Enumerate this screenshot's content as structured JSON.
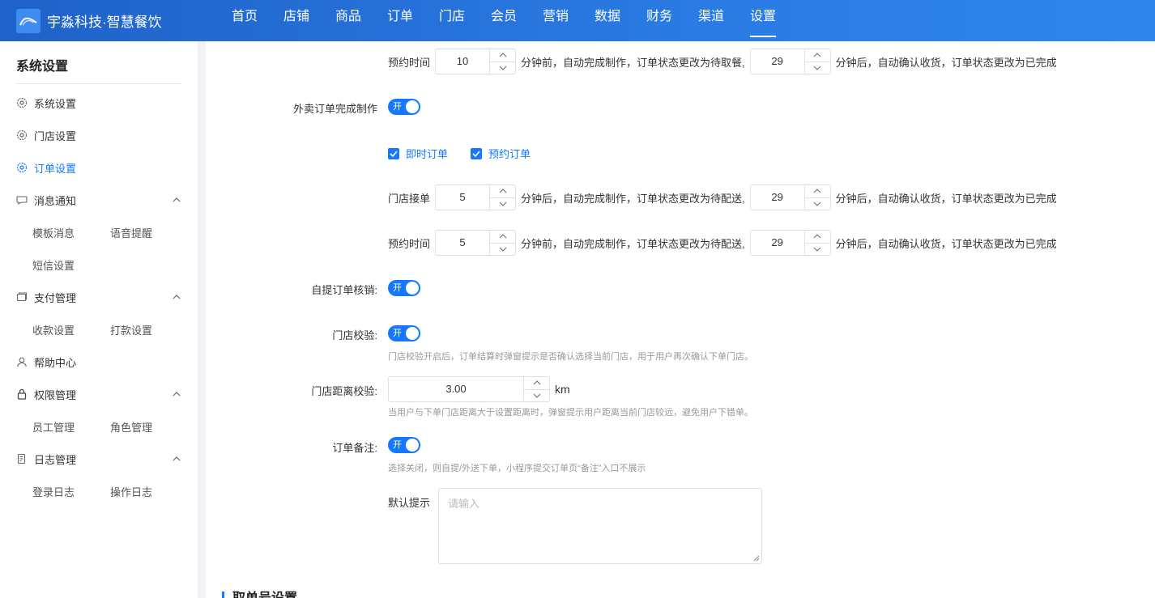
{
  "header": {
    "brand": "宇淼科技·智慧餐饮",
    "nav": [
      "首页",
      "店铺",
      "商品",
      "订单",
      "门店",
      "会员",
      "营销",
      "数据",
      "财务",
      "渠道",
      "设置"
    ],
    "active_nav": "设置"
  },
  "sidebar": {
    "title": "系统设置",
    "items": {
      "system": "系统设置",
      "store": "门店设置",
      "order": "订单设置",
      "message": "消息通知",
      "template": "模板消息",
      "voice": "语音提醒",
      "sms": "短信设置",
      "payment": "支付管理",
      "collect": "收款设置",
      "payout": "打款设置",
      "help": "帮助中心",
      "permission": "权限管理",
      "staff": "员工管理",
      "role": "角色管理",
      "log": "日志管理",
      "login_log": "登录日志",
      "op_log": "操作日志"
    }
  },
  "main": {
    "row1": {
      "label": "预约时间",
      "value1": "10",
      "text1": "分钟前，自动完成制作，订单状态更改为待取餐,",
      "value2": "29",
      "text2": "分钟后，自动确认收货，订单状态更改为已完成"
    },
    "delivery": {
      "label": "外卖订单完成制作",
      "switch": "开"
    },
    "checkbox_instant": "即时订单",
    "checkbox_reserve": "预约订单",
    "row2": {
      "label": "门店接单",
      "value1": "5",
      "text1": "分钟后，自动完成制作，订单状态更改为待配送,",
      "value2": "29",
      "text2": "分钟后，自动确认收货，订单状态更改为已完成"
    },
    "row3": {
      "label": "预约时间",
      "value1": "5",
      "text1": "分钟前，自动完成制作，订单状态更改为待配送,",
      "value2": "29",
      "text2": "分钟后，自动确认收货，订单状态更改为已完成"
    },
    "pickup": {
      "label": "自提订单核销:",
      "switch": "开"
    },
    "store_check": {
      "label": "门店校验:",
      "switch": "开",
      "hint": "门店校验开启后，订单结算时弹窗提示是否确认选择当前门店，用于用户再次确认下单门店。"
    },
    "distance": {
      "label": "门店距离校验:",
      "value": "3.00",
      "unit": "km",
      "hint": "当用户与下单门店距离大于设置距离时，弹窗提示用户距离当前门店较远，避免用户下错单。"
    },
    "remark": {
      "label": "订单备注:",
      "switch": "开",
      "hint": "选择关闭，则自提/外送下单，小程序提交订单页“备注”入口不展示"
    },
    "default_tip": {
      "label": "默认提示",
      "placeholder": "请输入"
    },
    "section_next": "取单号设置"
  },
  "colors": {
    "primary": "#1677ff",
    "header_start": "#1f62c9",
    "header_end": "#2e86ea"
  }
}
